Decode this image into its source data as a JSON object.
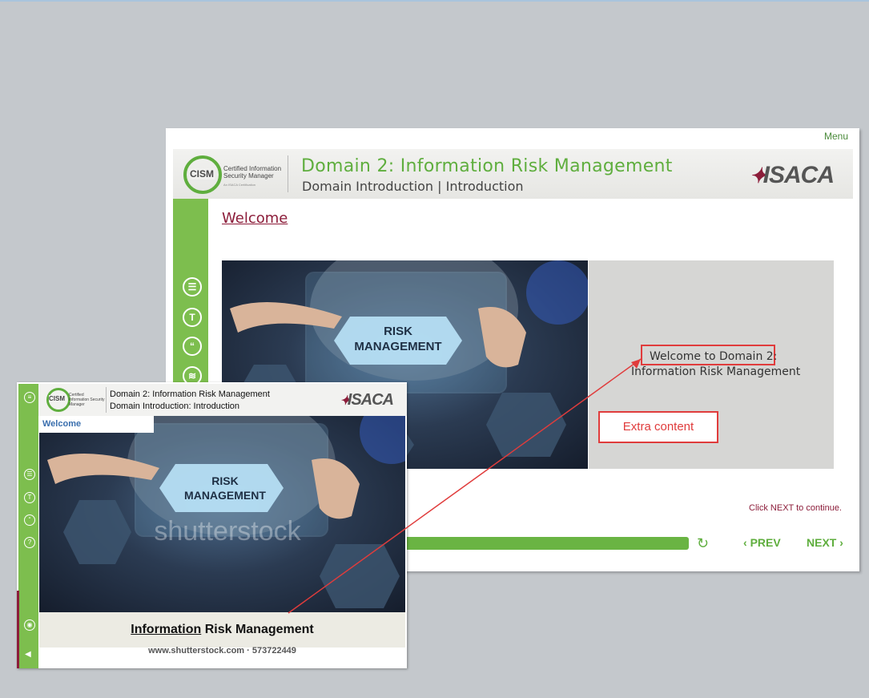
{
  "main": {
    "menu_label": "Menu",
    "logo_text": "CISM",
    "logo_subtitle": "Certified Information Security Manager",
    "logo_tagline": "An ISACA Certification",
    "title": "Domain 2: Information Risk Management",
    "subtitle": "Domain Introduction | Introduction",
    "brand": "ISACA",
    "page_heading": "Welcome",
    "image_caption_line1": "RISK",
    "image_caption_line2": "MANAGEMENT",
    "welcome_line1": "Welcome to Domain 2:",
    "welcome_line2": "Information Risk Management",
    "extra_content": "Extra content",
    "click_next": "Click NEXT to continue.",
    "prev_label": "PREV",
    "next_label": "NEXT",
    "sidebar_icons": [
      "notes-icon",
      "transcript-icon",
      "quote-icon",
      "layers-icon"
    ]
  },
  "inset": {
    "logo_text": "CISM",
    "logo_subtitle": "Certified Information Security Manager",
    "title_line1": "Domain 2: Information Risk Management",
    "title_line2": "Domain Introduction: Introduction",
    "brand": "ISACA",
    "welcome": "Welcome",
    "image_caption_line1": "RISK",
    "image_caption_line2": "MANAGEMENT",
    "watermark": "shutterstock",
    "caption_underlined": "Information",
    "caption_rest": " Risk Management",
    "footer": "www.shutterstock.com · 573722449"
  },
  "colors": {
    "accent_green": "#5fae3e",
    "sidebar_green": "#7dbe4e",
    "maroon": "#8c1d3a",
    "annotation_red": "#e03c3c"
  }
}
